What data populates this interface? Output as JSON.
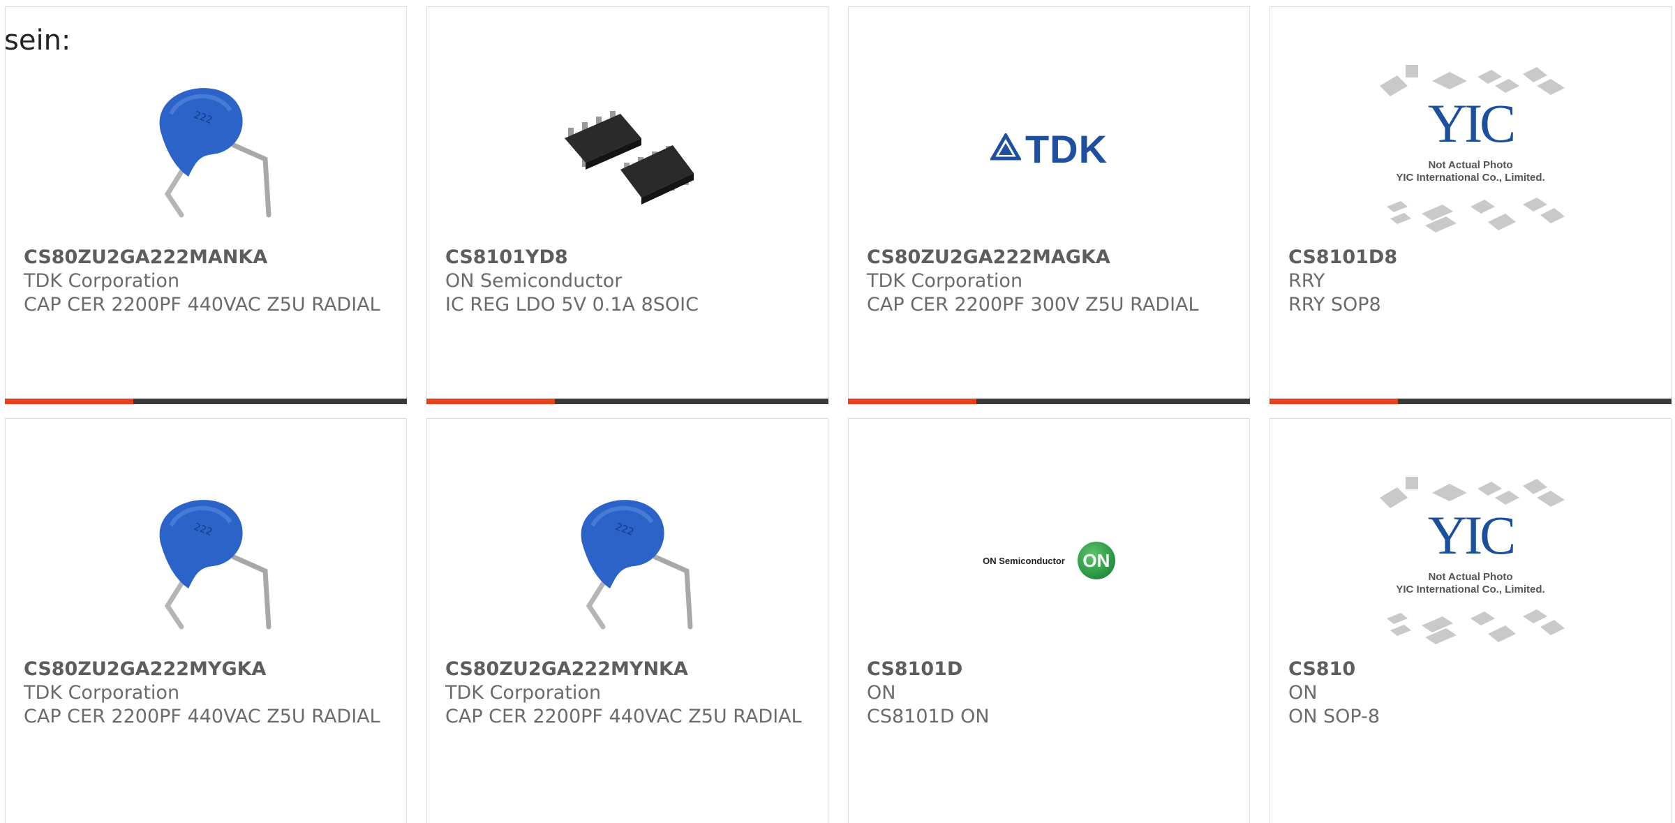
{
  "lead_text": "sein:",
  "colors": {
    "accent": "#e8401c",
    "bar": "#3a3a3a",
    "text": "#6b6b6b"
  },
  "cards": [
    {
      "part_number": "CS80ZU2GA222MANKA",
      "manufacturer": "TDK Corporation",
      "description": "CAP CER 2200PF 440VAC Z5U RADIAL",
      "image": "blue-ceramic-capacitor-icon"
    },
    {
      "part_number": "CS8101YD8",
      "manufacturer": "ON Semiconductor",
      "description": "IC REG LDO 5V 0.1A 8SOIC",
      "image": "soic-8-chip-icon"
    },
    {
      "part_number": "CS80ZU2GA222MAGKA",
      "manufacturer": "TDK Corporation",
      "description": "CAP CER 2200PF 300V Z5U RADIAL",
      "image": "tdk-logo",
      "logo_text": "TDK"
    },
    {
      "part_number": "CS8101D8",
      "manufacturer": "RRY",
      "description": "RRY SOP8",
      "image": "yic-placeholder",
      "logo_text": "YIC",
      "caption_line1": "Not Actual Photo",
      "caption_line2": "YIC International Co., Limited."
    },
    {
      "part_number": "CS80ZU2GA222MYGKA",
      "manufacturer": "TDK Corporation",
      "description": "CAP CER 2200PF 440VAC Z5U RADIAL",
      "image": "blue-ceramic-capacitor-icon"
    },
    {
      "part_number": "CS80ZU2GA222MYNKA",
      "manufacturer": "TDK Corporation",
      "description": "CAP CER 2200PF 440VAC Z5U RADIAL",
      "image": "blue-ceramic-capacitor-icon"
    },
    {
      "part_number": "CS8101D",
      "manufacturer": "ON",
      "description": "CS8101D ON",
      "image": "on-semiconductor-logo",
      "logo_text": "ON Semiconductor",
      "logo_badge": "ON"
    },
    {
      "part_number": "CS810",
      "manufacturer": "ON",
      "description": "ON SOP-8",
      "image": "yic-placeholder",
      "logo_text": "YIC",
      "caption_line1": "Not Actual Photo",
      "caption_line2": "YIC International Co., Limited."
    }
  ]
}
